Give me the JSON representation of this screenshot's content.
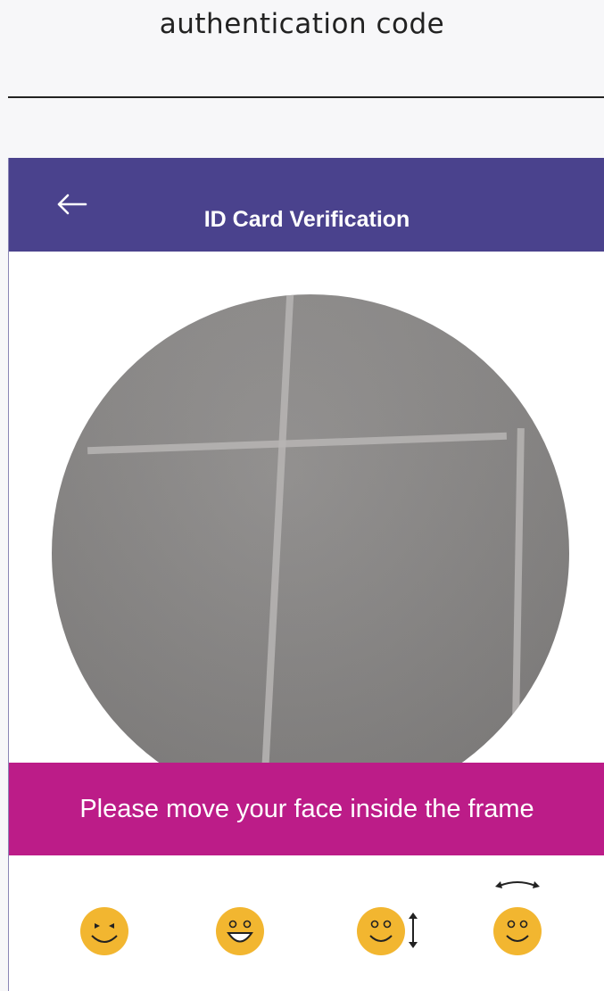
{
  "caption": {
    "text": "authentication code"
  },
  "app_bar": {
    "title": "ID Card Verification",
    "back_icon": "arrow-left-icon",
    "background": "#4a428d"
  },
  "camera": {
    "preview": "camera-preview"
  },
  "banner": {
    "message": "Please move your face inside the frame",
    "background": "#bc1c88"
  },
  "actions": [
    {
      "icon": "smile-eyes-closed-icon",
      "label": ""
    },
    {
      "icon": "open-mouth-smile-icon",
      "label": ""
    },
    {
      "icon": "nod-face-icon",
      "label": ""
    },
    {
      "icon": "turn-head-face-icon",
      "label": ""
    }
  ],
  "colors": {
    "face": "#f2b630",
    "face_features": "#222222"
  }
}
